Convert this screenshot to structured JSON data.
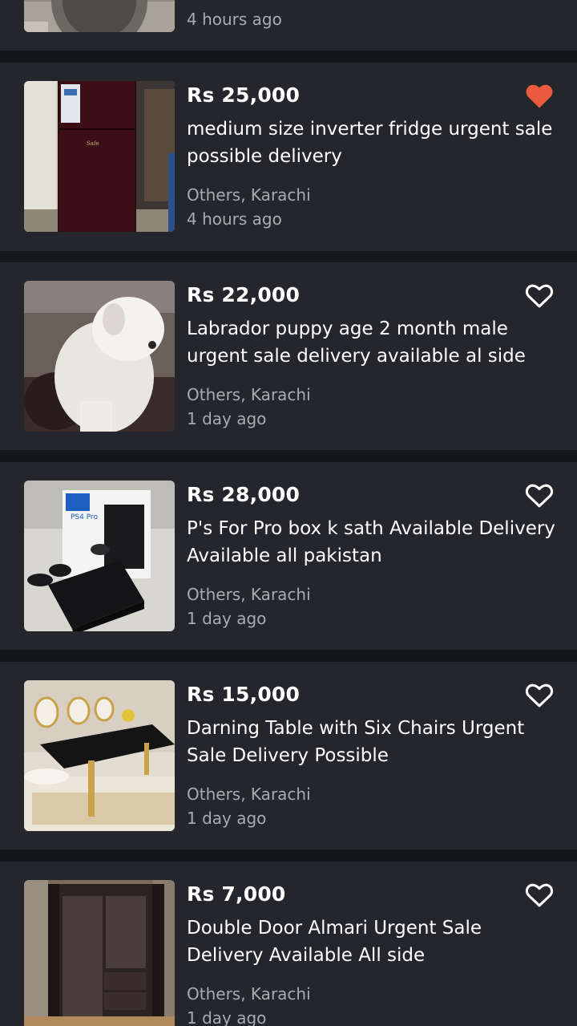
{
  "colors": {
    "background": "#15171b",
    "card": "#24262b",
    "text_primary": "#ffffff",
    "text_secondary": "#a9abaf",
    "favorite_active": "#ea5a3c"
  },
  "listings": [
    {
      "price": "",
      "title": "",
      "location": "",
      "time": "4 hours ago",
      "favorite_icon": "heart-outline-icon",
      "favorited": false,
      "image": "washing-machine-photo"
    },
    {
      "price": "Rs 25,000",
      "title": "medium size inverter fridge urgent sale possible delivery",
      "location": "Others, Karachi",
      "time": "4 hours ago",
      "favorite_icon": "heart-filled-icon",
      "favorited": true,
      "image": "fridge-photo"
    },
    {
      "price": "Rs 22,000",
      "title": "Labrador puppy age 2 month male urgent sale delivery available al side",
      "location": "Others, Karachi",
      "time": "1 day ago",
      "favorite_icon": "heart-outline-icon",
      "favorited": false,
      "image": "puppy-photo"
    },
    {
      "price": "Rs 28,000",
      "title": "P's For Pro box k sath Available Delivery Available all pakistan",
      "location": "Others, Karachi",
      "time": "1 day ago",
      "favorite_icon": "heart-outline-icon",
      "favorited": false,
      "image": "ps4-pro-photo"
    },
    {
      "price": "Rs 15,000",
      "title": "Darning Table with Six Chairs Urgent Sale Delivery Possible",
      "location": "Others, Karachi",
      "time": "1 day ago",
      "favorite_icon": "heart-outline-icon",
      "favorited": false,
      "image": "dining-table-photo"
    },
    {
      "price": "Rs 7,000",
      "title": "Double Door Almari Urgent Sale Delivery Available All side",
      "location": "Others, Karachi",
      "time": "1 day ago",
      "favorite_icon": "heart-outline-icon",
      "favorited": false,
      "image": "wardrobe-photo"
    }
  ]
}
